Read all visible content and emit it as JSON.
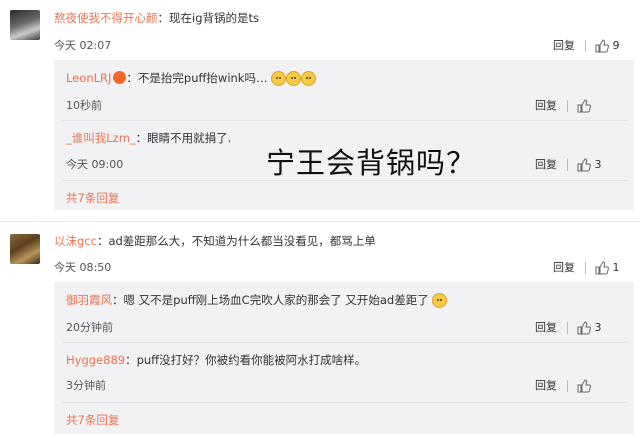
{
  "overlay_text": "宁王会背锅吗？",
  "comments": [
    {
      "user": "熬夜使我不得开心颜",
      "text": "：现在ig背锅的是ts",
      "time": "今天 02:07",
      "reply_label": "回复",
      "likes": "9",
      "replies": [
        {
          "user": "LeonLRJ",
          "text": "：不是抬完puff抬wink吗…",
          "time": "10秒前",
          "reply_label": "回复",
          "likes": ""
        },
        {
          "user": "_谁叫我Lzm_",
          "text": "：眼睛不用就捐了.",
          "time": "今天 09:00",
          "reply_label": "回复",
          "likes": "3"
        }
      ],
      "more": "共7条回复"
    },
    {
      "user": "以沫gcc",
      "text": "：ad差距那么大，不知道为什么都当没看见，都骂上单",
      "time": "今天 08:50",
      "reply_label": "回复",
      "likes": "1",
      "replies": [
        {
          "user": "御羽霞风",
          "text": "：嗯 又不是puff刚上场血C完吹人家的那会了 又开始ad差距了",
          "time": "20分钟前",
          "reply_label": "回复",
          "likes": "3"
        },
        {
          "user": "Hygge889",
          "text": "：puff没打好？你被约看你能被阿水打成啥样。",
          "time": "3分钟前",
          "reply_label": "回复",
          "likes": ""
        }
      ],
      "more": "共7条回复"
    }
  ]
}
